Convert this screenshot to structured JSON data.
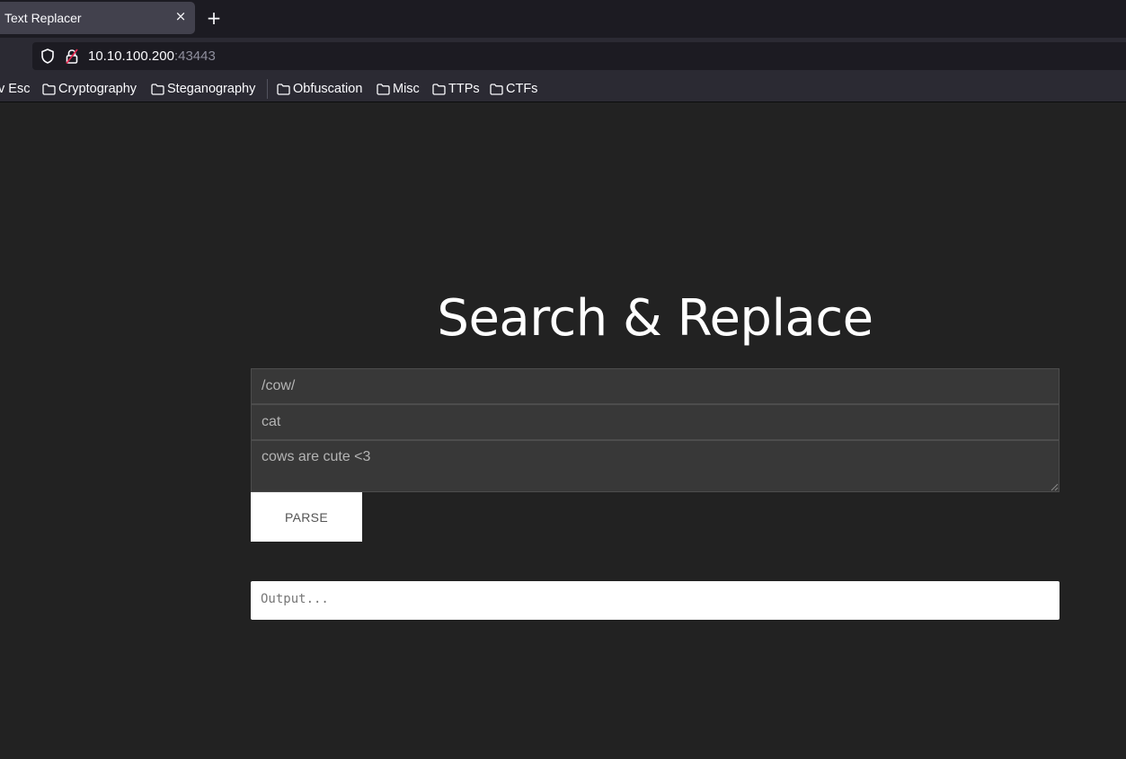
{
  "browser": {
    "tab_title": "Text Replacer",
    "close_glyph": "×",
    "new_tab_glyph": "+",
    "url_host": "10.10.100.200",
    "url_port": ":43443",
    "bookmarks": [
      "v Esc",
      "Cryptography",
      "Steganography",
      "Obfuscation",
      "Misc",
      "TTPs",
      "CTFs"
    ]
  },
  "page": {
    "heading": "Search & Replace",
    "search_value": "/cow/",
    "replace_value": "cat",
    "text_value": "cows are cute <3",
    "parse_label": "PARSE",
    "output_placeholder": "Output..."
  },
  "colors": {
    "background": "#222222",
    "field_bg": "#383838",
    "button_bg": "#ffffff"
  }
}
